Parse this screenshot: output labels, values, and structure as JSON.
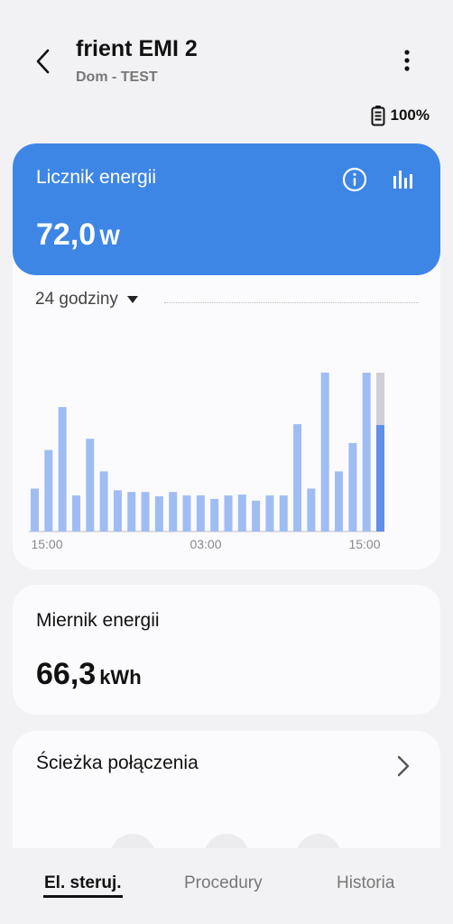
{
  "header": {
    "title": "frient EMI 2",
    "subtitle": "Dom - TEST",
    "battery": "100%"
  },
  "energy_card": {
    "label": "Licznik energii",
    "value": "72,0",
    "unit": "W",
    "period": "24 godziny"
  },
  "chart_data": {
    "type": "bar",
    "x_tick_labels": [
      "15:00",
      "03:00",
      "15:00"
    ],
    "values": [
      50,
      95,
      145,
      42,
      108,
      70,
      48,
      46,
      46,
      41,
      46,
      42,
      42,
      38,
      42,
      43,
      36,
      42,
      42,
      125,
      50,
      185,
      70,
      103,
      185,
      124
    ],
    "last_bar_total": 185,
    "colors": {
      "bar": "#9fbdf3",
      "current_bar": "#5f8fe6",
      "remainder": "#cfcfd4"
    }
  },
  "meter_card": {
    "label": "Miernik energii",
    "value": "66,3",
    "unit": "kWh"
  },
  "path_card": {
    "label": "Ścieżka połączenia"
  },
  "tabs": [
    {
      "label": "El. steruj."
    },
    {
      "label": "Procedury"
    },
    {
      "label": "Historia"
    }
  ],
  "colors": {
    "accent": "#3e86e6",
    "background": "#f2f2f4"
  }
}
